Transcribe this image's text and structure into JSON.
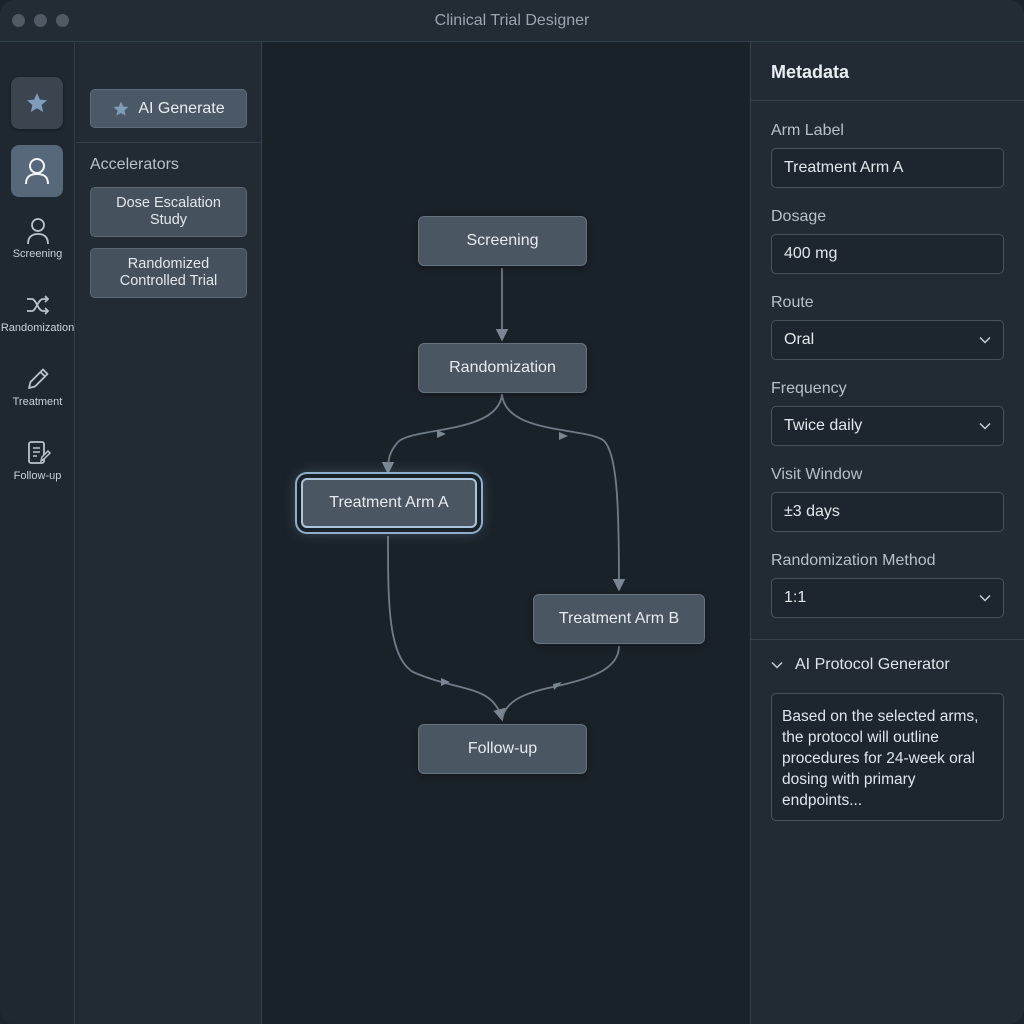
{
  "window": {
    "title": "Clinical Trial Designer"
  },
  "rail": {
    "items": [
      {
        "label": "Screening",
        "icon": "person-icon"
      },
      {
        "label": "Randomization",
        "icon": "shuffle-icon"
      },
      {
        "label": "Treatment",
        "icon": "pencil-icon"
      },
      {
        "label": "Follow-up",
        "icon": "clipboard-edit-icon"
      }
    ]
  },
  "library": {
    "ai_generate_label": "AI Generate",
    "accelerators_title": "Accelerators",
    "accelerators": [
      {
        "label": "Dose Escalation Study"
      },
      {
        "label": "Randomized Controlled Trial"
      }
    ]
  },
  "canvas": {
    "nodes": {
      "screening": "Screening",
      "randomization": "Randomization",
      "arm_a": "Treatment Arm A",
      "arm_b": "Treatment Arm B",
      "followup": "Follow-up"
    },
    "selected_node": "arm_a"
  },
  "metadata": {
    "title": "Metadata",
    "arm_label": {
      "label": "Arm Label",
      "value": "Treatment Arm A"
    },
    "dosage": {
      "label": "Dosage",
      "value": "400 mg"
    },
    "route": {
      "label": "Route",
      "value": "Oral"
    },
    "frequency": {
      "label": "Frequency",
      "value": "Twice daily"
    },
    "visit_window": {
      "label": "Visit Window",
      "value": "±3 days"
    },
    "randomization_method": {
      "label": "Randomization Method",
      "value": "1:1"
    },
    "generator": {
      "title": "AI Protocol Generator",
      "text": "Based on the selected arms, the protocol will outline procedures for 24-week oral dosing with primary endpoints..."
    }
  },
  "colors": {
    "accent_selected": "#a9c4dc",
    "star_icon": "#7f9dbb"
  }
}
